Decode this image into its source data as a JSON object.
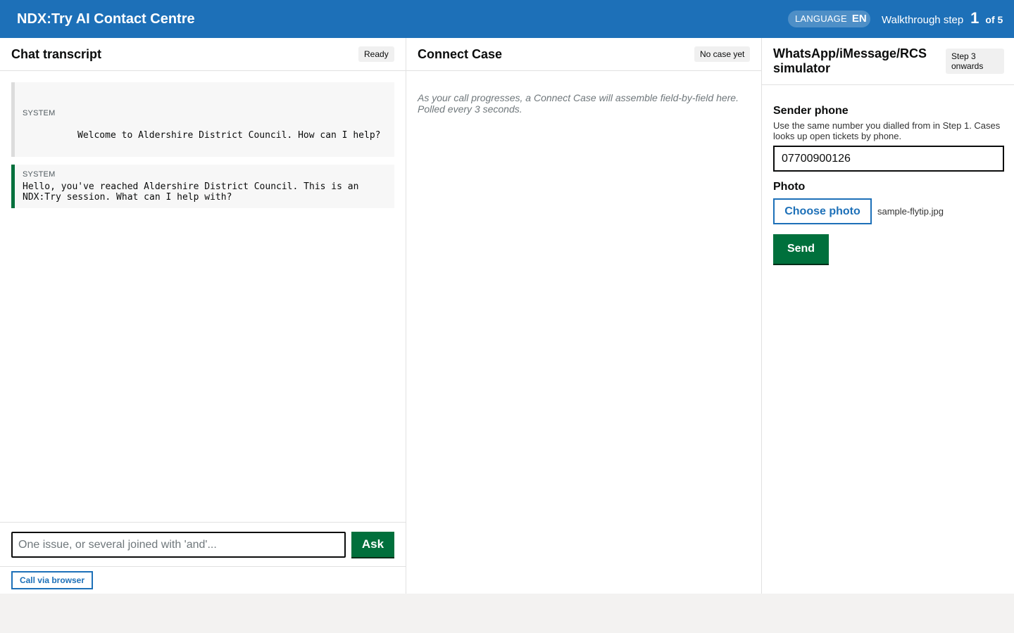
{
  "header": {
    "title": "NDX:Try AI Contact Centre",
    "language_label": "LANGUAGE",
    "language_code": "EN",
    "walkthrough_label": "Walkthrough step",
    "walkthrough_step": "1",
    "walkthrough_total": "of 5",
    "bar_color": "#1d70b8"
  },
  "chat": {
    "title": "Chat transcript",
    "status": "Ready",
    "messages": [
      {
        "role": "SYSTEM",
        "text": "Welcome to Aldershire District Council. How can I help?"
      },
      {
        "role": "SYSTEM",
        "text": "Hello, you've reached Aldershire District Council. This is an NDX:Try session. What can I help with?"
      }
    ],
    "input_placeholder": "One issue, or several joined with 'and'...",
    "input_value": "",
    "ask_label": "Ask",
    "call_label": "Call via browser"
  },
  "case": {
    "title": "Connect Case",
    "status": "No case yet",
    "hint": "As your call progresses, a Connect Case will assemble field-by-field here. Polled every 3 seconds."
  },
  "simulator": {
    "title": "WhatsApp/iMessage/RCS simulator",
    "step_badge": "Step 3 onwards",
    "phone_label": "Sender phone",
    "phone_hint": "Use the same number you dialled from in Step 1. Cases looks up open tickets by phone.",
    "phone_value": "07700900126",
    "photo_label": "Photo",
    "choose_label": "Choose photo",
    "file_name": "sample-flytip.jpg",
    "send_label": "Send"
  },
  "colors": {
    "primary_blue": "#1d70b8",
    "action_green": "#00703c",
    "page_background": "#f3f2f1"
  }
}
